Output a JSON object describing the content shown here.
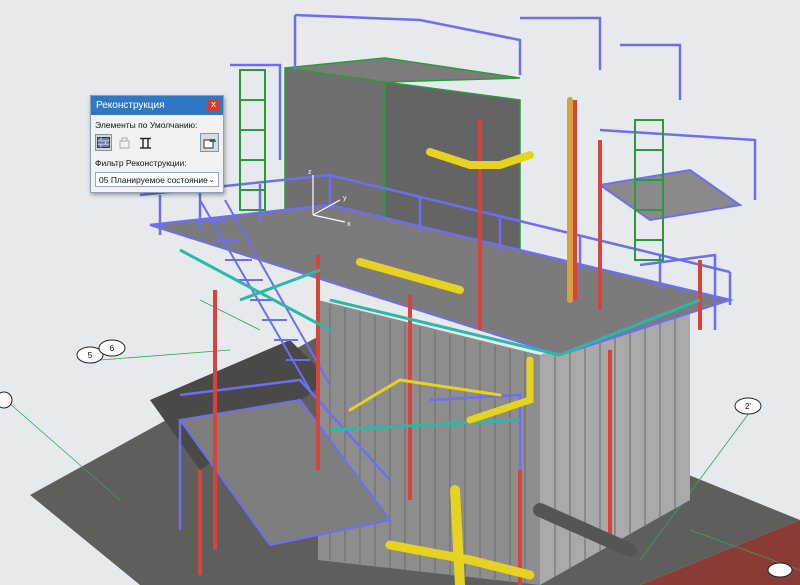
{
  "palette": {
    "title": "Реконструкция",
    "close_glyph": "x",
    "defaults_label": "Элементы по Умолчанию:",
    "filter_label": "Фильтр Реконструкции:",
    "filter_value": "05 Планируемое состояние",
    "tools": [
      "existing-elements-icon",
      "demolish-elements-icon",
      "new-elements-icon"
    ],
    "settings_icon": "override-style-icon",
    "accent": "#2f78c4",
    "close_color": "#d83a2f"
  },
  "viewport": {
    "grid_bubbles": [
      "5",
      "6",
      "2'"
    ],
    "axes": [
      "z",
      "y",
      "x"
    ],
    "colors": {
      "railing": "#6e6ef0",
      "column": "#d8443a",
      "beam": "#2bb8a8",
      "pipe": "#e6d220",
      "green_ladder": "#2a9a3a",
      "wall": "#6b6b6b"
    }
  }
}
